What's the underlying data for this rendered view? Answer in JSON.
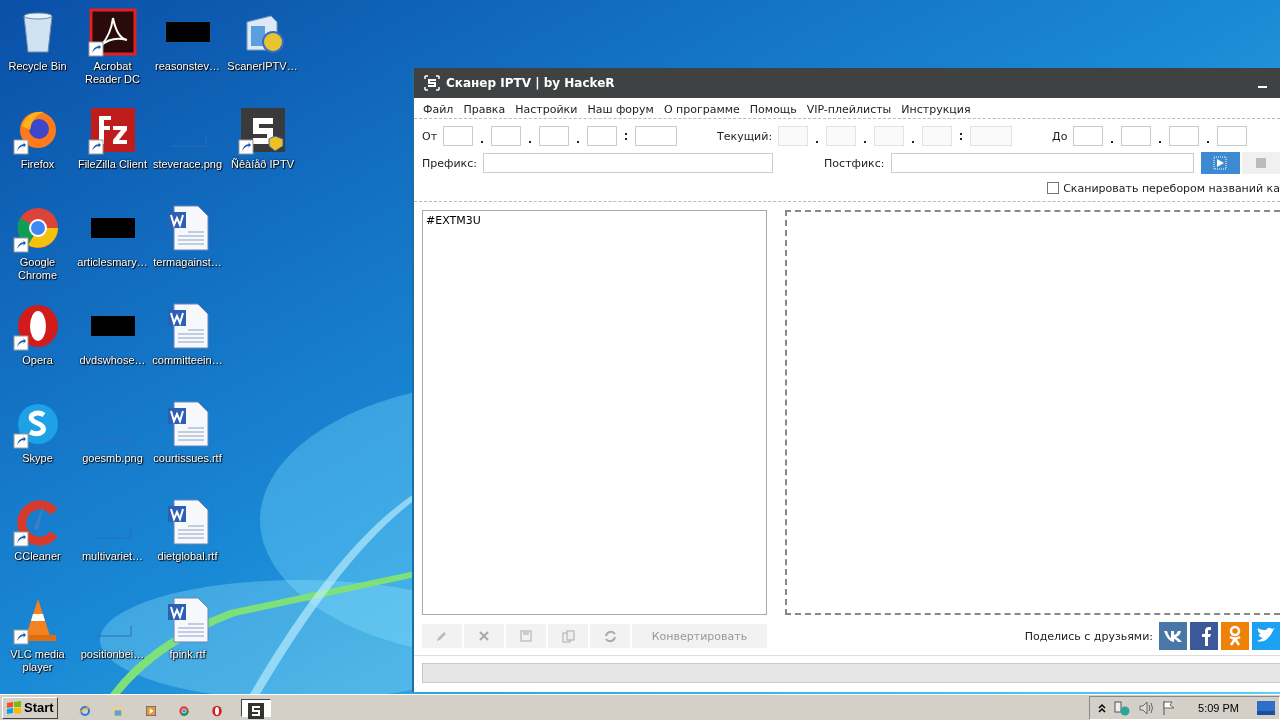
{
  "desktop_icons": [
    {
      "label": "Recycle Bin",
      "kind": "recycle",
      "shortcut": false
    },
    {
      "label": "Firefox",
      "kind": "firefox",
      "shortcut": true
    },
    {
      "label": "Google Chrome",
      "kind": "chrome",
      "shortcut": true
    },
    {
      "label": "Opera",
      "kind": "opera",
      "shortcut": true
    },
    {
      "label": "Skype",
      "kind": "skype",
      "shortcut": true
    },
    {
      "label": "CCleaner",
      "kind": "ccleaner",
      "shortcut": true
    },
    {
      "label": "VLC media player",
      "kind": "vlc",
      "shortcut": true
    },
    {
      "label": "Acrobat Reader DC",
      "kind": "acrobat",
      "shortcut": true
    },
    {
      "label": "FileZilla Client",
      "kind": "filezilla",
      "shortcut": true
    },
    {
      "label": "articlesmary…",
      "kind": "black",
      "shortcut": false
    },
    {
      "label": "dvdswhose…",
      "kind": "black",
      "shortcut": false
    },
    {
      "label": "goesmb.png",
      "kind": "blank",
      "shortcut": false
    },
    {
      "label": "multivariet…",
      "kind": "blank",
      "shortcut": false
    },
    {
      "label": "positionbei…",
      "kind": "blank",
      "shortcut": false
    },
    {
      "label": "reasonstev…",
      "kind": "black",
      "shortcut": false
    },
    {
      "label": "steverace.png",
      "kind": "blank",
      "shortcut": false
    },
    {
      "label": "termagainst…",
      "kind": "word",
      "shortcut": false
    },
    {
      "label": "committeein…",
      "kind": "word",
      "shortcut": false
    },
    {
      "label": "courtissues.rtf",
      "kind": "word",
      "shortcut": false
    },
    {
      "label": "dietglobal.rtf",
      "kind": "word",
      "shortcut": false
    },
    {
      "label": "fpink.rtf",
      "kind": "word",
      "shortcut": false
    },
    {
      "label": "ScanerIPTV…",
      "kind": "installer",
      "shortcut": false
    },
    {
      "label": "Ñêàíåð IPTV",
      "kind": "scanner",
      "shortcut": true
    }
  ],
  "window": {
    "title": "Сканер IPTV | by HackeR",
    "menu": [
      "Файл",
      "Правка",
      "Настройки",
      "Наш форум",
      "О программе",
      "Помощь",
      "VIP-плейлисты",
      "Инструкция"
    ],
    "ip_ranges": [
      {
        "label": "От"
      },
      {
        "label": "Текущий:"
      },
      {
        "label": "До"
      }
    ],
    "prefix": {
      "label": "Префикс:"
    },
    "postfix": {
      "label": "Постфикс:"
    },
    "scan_names": {
      "label": "Сканировать перебором названий ка",
      "checked": false
    },
    "playlist": {
      "value": "#EXTM3U"
    },
    "toolbar": [
      {
        "kind": "edit",
        "disabled": true
      },
      {
        "kind": "delete",
        "disabled": true
      },
      {
        "kind": "save",
        "disabled": true
      },
      {
        "kind": "copy",
        "disabled": true
      },
      {
        "kind": "refresh",
        "disabled": true
      },
      {
        "kind": "text",
        "label": "Конвертировать",
        "disabled": true
      }
    ],
    "share": {
      "label": "Поделись с друзьями:",
      "networks": [
        {
          "kind": "vk",
          "color": "#4a76a8"
        },
        {
          "kind": "facebook",
          "color": "#3b5998"
        },
        {
          "kind": "ok",
          "color": "#ee8208"
        },
        {
          "kind": "twitter",
          "color": "#1da1f2"
        }
      ]
    }
  },
  "taskbar": {
    "start": "Start",
    "apps": [
      {
        "kind": "ie",
        "selected": false
      },
      {
        "kind": "folder",
        "selected": false
      },
      {
        "kind": "media",
        "selected": false
      },
      {
        "kind": "chrome",
        "selected": false
      },
      {
        "kind": "opera",
        "selected": false
      },
      {
        "kind": "scanner",
        "selected": true
      }
    ],
    "clock": "5:09 PM"
  }
}
